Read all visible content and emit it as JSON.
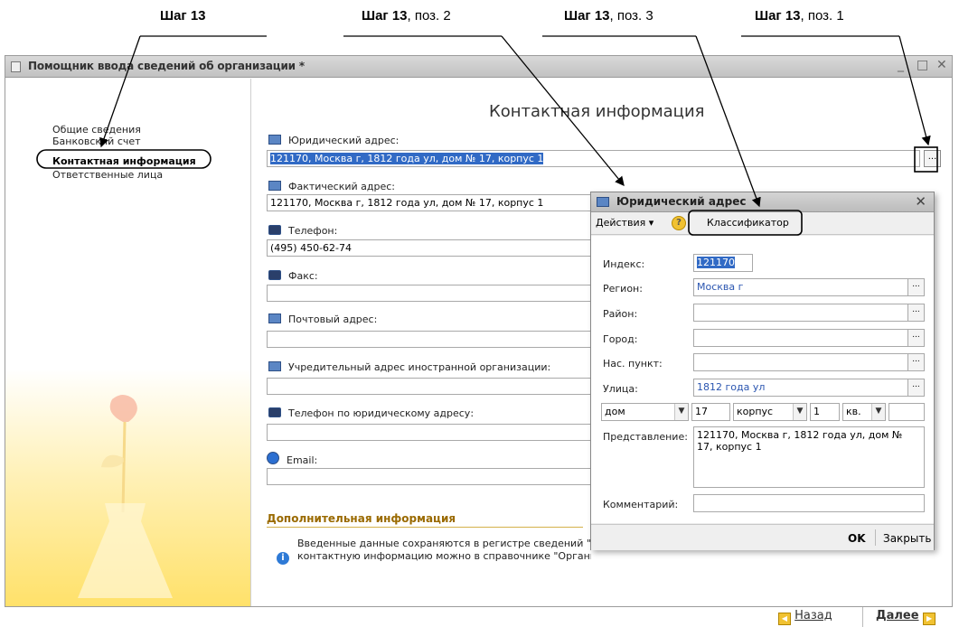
{
  "callouts": [
    {
      "bold": "Шаг 13",
      "rest": ""
    },
    {
      "bold": "Шаг 13",
      "rest": ", поз. 2"
    },
    {
      "bold": "Шаг 13",
      "rest": ", поз. 3"
    },
    {
      "bold": "Шаг 13",
      "rest": ", поз. 1"
    }
  ],
  "window": {
    "title": "Помощник ввода сведений об организации *",
    "controls": {
      "minimize": "_",
      "maximize": "□",
      "close": "✕"
    }
  },
  "nav": {
    "items": [
      {
        "label": "Общие сведения",
        "selected": false
      },
      {
        "label": "Банковский счет",
        "selected": false
      },
      {
        "label": "Контактная информация",
        "selected": true
      },
      {
        "label": "Ответственные лица",
        "selected": false
      }
    ]
  },
  "main": {
    "heading": "Контактная информация",
    "fields": [
      {
        "label": "Юридический адрес:",
        "value": "121170, Москва г, 1812 года ул, дом № 17, корпус 1",
        "icon": "address-icon"
      },
      {
        "label": "Фактический адрес:",
        "value": "121170, Москва г, 1812 года ул, дом № 17, корпус 1",
        "icon": "address-icon"
      },
      {
        "label": "Телефон:",
        "value": "(495) 450-62-74",
        "icon": "phone-icon"
      },
      {
        "label": "Факс:",
        "value": "",
        "icon": "fax-icon"
      },
      {
        "label": "Почтовый адрес:",
        "value": "",
        "icon": "address-icon"
      },
      {
        "label": "Учредительный адрес иностранной организации:",
        "value": "",
        "icon": "address-icon"
      },
      {
        "label": "Телефон по юридическому адресу:",
        "value": "",
        "icon": "phone-icon"
      },
      {
        "label": "Email:",
        "value": "",
        "icon": "email-icon"
      }
    ],
    "dots_label": "...",
    "additional_title": "Дополнительная информация",
    "info_line1": "Введенные данные сохраняются в регистре сведений \"",
    "info_line2": "контактную информацию можно в справочнике \"Органи",
    "back_label": "Назад",
    "next_label": "Далее"
  },
  "dialog": {
    "title": "Юридический адрес",
    "actions_label": "Действия ▾",
    "help_label": "?",
    "classifier_label": "Классификатор",
    "index_label": "Индекс:",
    "index_value": "121170",
    "region_label": "Регион:",
    "region_value": "Москва г",
    "district_label": "Район:",
    "district_value": "",
    "city_label": "Город:",
    "city_value": "",
    "settlement_label": "Нас. пункт:",
    "settlement_value": "",
    "street_label": "Улица:",
    "street_value": "1812 года ул",
    "house_type": "дом",
    "house_num": "17",
    "building_type": "корпус",
    "building_num": "1",
    "flat_type": "кв.",
    "flat_num": "",
    "presentation_label": "Представление:",
    "presentation_value": "121170, Москва г, 1812 года ул, дом № 17, корпус 1",
    "comment_label": "Комментарий:",
    "comment_value": "",
    "ok_label": "OK",
    "close_label": "Закрыть"
  }
}
